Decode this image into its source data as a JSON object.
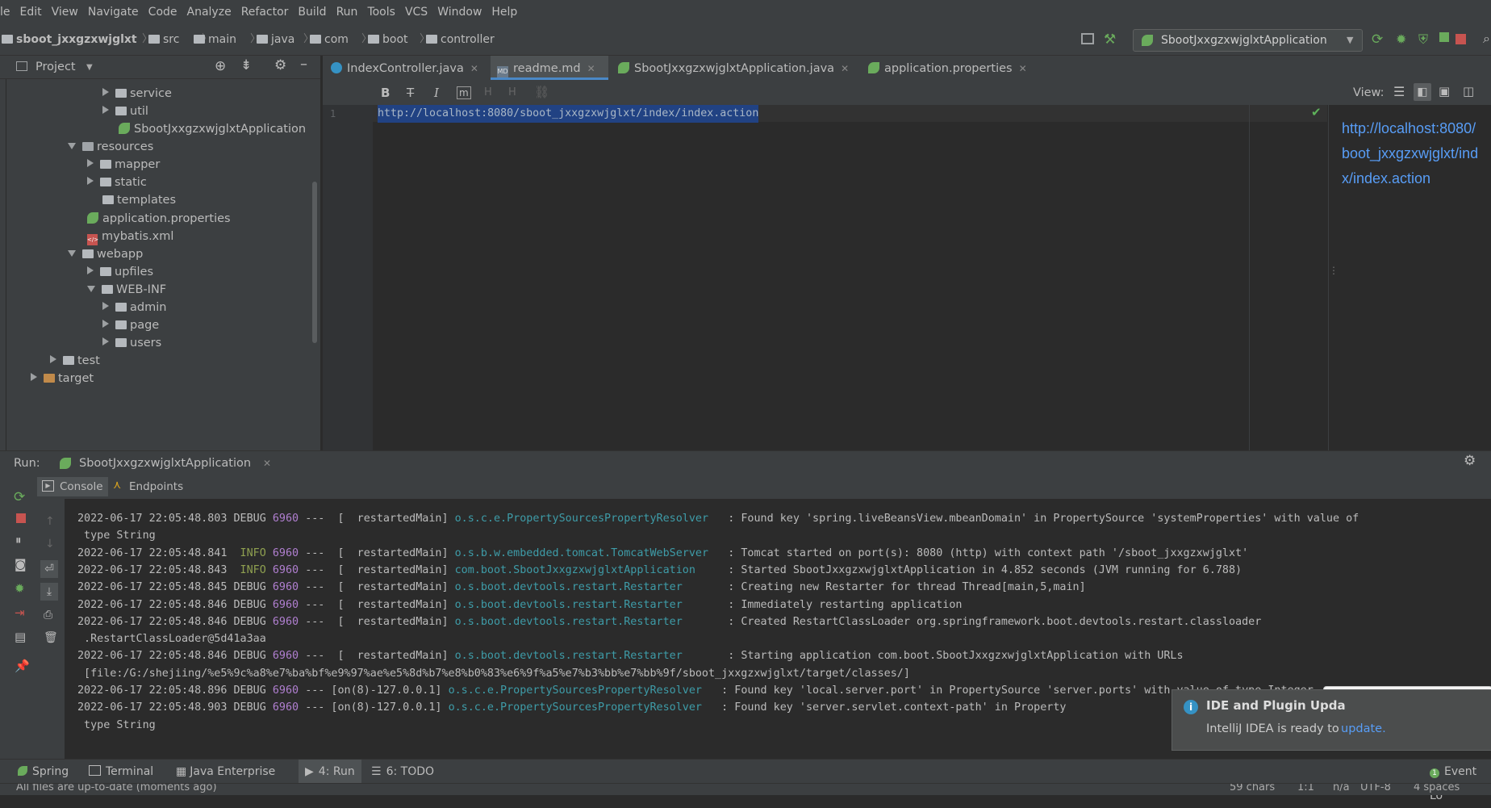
{
  "menu": [
    "le",
    "Edit",
    "View",
    "Navigate",
    "Code",
    "Analyze",
    "Refactor",
    "Build",
    "Run",
    "Tools",
    "VCS",
    "Window",
    "Help"
  ],
  "breadcrumb": [
    "sboot_jxxgzxwjglxt",
    "src",
    "main",
    "java",
    "com",
    "boot",
    "controller"
  ],
  "run_config": "SbootJxxgzxwjglxtApplication",
  "project_panel": {
    "title": "Project",
    "tree": [
      {
        "label": "service",
        "type": "folder",
        "expand": "collapsed"
      },
      {
        "label": "util",
        "type": "folder",
        "expand": "collapsed"
      },
      {
        "label": "SbootJxxgzxwjglxtApplication",
        "type": "spring-class",
        "expand": "none"
      },
      {
        "label": "resources",
        "type": "resfolder",
        "expand": "expanded"
      },
      {
        "label": "mapper",
        "type": "folder",
        "expand": "collapsed"
      },
      {
        "label": "static",
        "type": "folder",
        "expand": "collapsed"
      },
      {
        "label": "templates",
        "type": "folder",
        "expand": "none"
      },
      {
        "label": "application.properties",
        "type": "properties",
        "expand": "none"
      },
      {
        "label": "mybatis.xml",
        "type": "xml",
        "expand": "none"
      },
      {
        "label": "webapp",
        "type": "folder",
        "expand": "expanded"
      },
      {
        "label": "upfiles",
        "type": "folder",
        "expand": "collapsed"
      },
      {
        "label": "WEB-INF",
        "type": "folder",
        "expand": "expanded"
      },
      {
        "label": "admin",
        "type": "folder",
        "expand": "collapsed"
      },
      {
        "label": "page",
        "type": "folder",
        "expand": "collapsed"
      },
      {
        "label": "users",
        "type": "folder",
        "expand": "collapsed"
      },
      {
        "label": "test",
        "type": "folder",
        "expand": "collapsed"
      },
      {
        "label": "target",
        "type": "brownfolder",
        "expand": "collapsed"
      }
    ]
  },
  "editor_tabs": [
    {
      "label": "IndexController.java",
      "icon": "class-icon",
      "active": false
    },
    {
      "label": "readme.md",
      "icon": "markdown-icon",
      "active": true
    },
    {
      "label": "SbootJxxgzxwjglxtApplication.java",
      "icon": "spring-icon",
      "active": false
    },
    {
      "label": "application.properties",
      "icon": "leaf-icon",
      "active": false
    }
  ],
  "editor_toolbar": {
    "view_label": "View:"
  },
  "editor": {
    "line_number": "1",
    "line_text": "http://localhost:8080/sboot_jxxgzxwjglxt/index/index.action"
  },
  "preview": {
    "lines": [
      "http://localhost:8080/",
      "boot_jxxgzxwjglxt/ind",
      "x/index.action"
    ]
  },
  "run_panel": {
    "label": "Run:",
    "tab": "SbootJxxgzxwjglxtApplication",
    "console_tab": "Console",
    "endpoints_tab": "Endpoints"
  },
  "log": [
    {
      "ts": "2022-06-17 22:05:48.803",
      "level": "DEBUG",
      "pid": "6960",
      "thread": "---  [  restartedMain]",
      "cls": "o.s.c.e.PropertySourcesPropertyResolver",
      "msg": "  : Found key 'spring.liveBeansView.mbeanDomain' in PropertySource 'systemProperties' with value of"
    },
    {
      "cont": " type String"
    },
    {
      "ts": "2022-06-17 22:05:48.841",
      "level": " INFO",
      "pid": "6960",
      "thread": "---  [  restartedMain]",
      "cls": "o.s.b.w.embedded.tomcat.TomcatWebServer",
      "msg": "  : Tomcat started on port(s): 8080 (http) with context path '/sboot_jxxgzxwjglxt'"
    },
    {
      "ts": "2022-06-17 22:05:48.843",
      "level": " INFO",
      "pid": "6960",
      "thread": "---  [  restartedMain]",
      "cls": "com.boot.SbootJxxgzxwjglxtApplication",
      "msg": "    : Started SbootJxxgzxwjglxtApplication in 4.852 seconds (JVM running for 6.788)"
    },
    {
      "ts": "2022-06-17 22:05:48.845",
      "level": "DEBUG",
      "pid": "6960",
      "thread": "---  [  restartedMain]",
      "cls": "o.s.boot.devtools.restart.Restarter",
      "msg": "      : Creating new Restarter for thread Thread[main,5,main]"
    },
    {
      "ts": "2022-06-17 22:05:48.846",
      "level": "DEBUG",
      "pid": "6960",
      "thread": "---  [  restartedMain]",
      "cls": "o.s.boot.devtools.restart.Restarter",
      "msg": "      : Immediately restarting application"
    },
    {
      "ts": "2022-06-17 22:05:48.846",
      "level": "DEBUG",
      "pid": "6960",
      "thread": "---  [  restartedMain]",
      "cls": "o.s.boot.devtools.restart.Restarter",
      "msg": "      : Created RestartClassLoader org.springframework.boot.devtools.restart.classloader"
    },
    {
      "cont": " .RestartClassLoader@5d41a3aa"
    },
    {
      "ts": "2022-06-17 22:05:48.846",
      "level": "DEBUG",
      "pid": "6960",
      "thread": "---  [  restartedMain]",
      "cls": "o.s.boot.devtools.restart.Restarter",
      "msg": "      : Starting application com.boot.SbootJxxgzxwjglxtApplication with URLs"
    },
    {
      "cont": " [file:/G:/shejiing/%e5%9c%a8%e7%ba%bf%e9%97%ae%e5%8d%b7%e8%b0%83%e6%9f%a5%e7%b3%bb%e7%bb%9f/sboot_jxxgzxwjglxt/target/classes/]"
    },
    {
      "ts": "2022-06-17 22:05:48.896",
      "level": "DEBUG",
      "pid": "6960",
      "thread": "--- [on(8)-127.0.0.1]",
      "cls": "o.s.c.e.PropertySourcesPropertyResolver",
      "msg": "  : Found key 'local.server.port' in PropertySource 'server.ports' with value of type Integer"
    },
    {
      "ts": "2022-06-17 22:05:48.903",
      "level": "DEBUG",
      "pid": "6960",
      "thread": "--- [on(8)-127.0.0.1]",
      "cls": "o.s.c.e.PropertySourcesPropertyResolver",
      "msg": "  : Found key 'server.servlet.context-path' in Property"
    },
    {
      "cont": " type String"
    }
  ],
  "bottom_tools": [
    {
      "label": "Spring"
    },
    {
      "label": "Terminal"
    },
    {
      "label": "Java Enterprise"
    },
    {
      "label": "4: Run"
    },
    {
      "label": "6: TODO"
    }
  ],
  "event_log": "Event Lo",
  "notification": {
    "title": "IDE and Plugin Upda",
    "body": "IntelliJ IDEA is ready to",
    "link": "update."
  },
  "ime": {
    "lang": "中"
  },
  "status": {
    "message": "All files are up-to-date (moments ago)",
    "chars": "59 chars",
    "pos": "1:1",
    "na": "n/a",
    "encoding": "UTF-8",
    "indent": "4 spaces"
  },
  "colors": {
    "accent": "#4a88c7",
    "spring_green": "#6aab5c",
    "link": "#589df6",
    "selection": "#214283"
  }
}
